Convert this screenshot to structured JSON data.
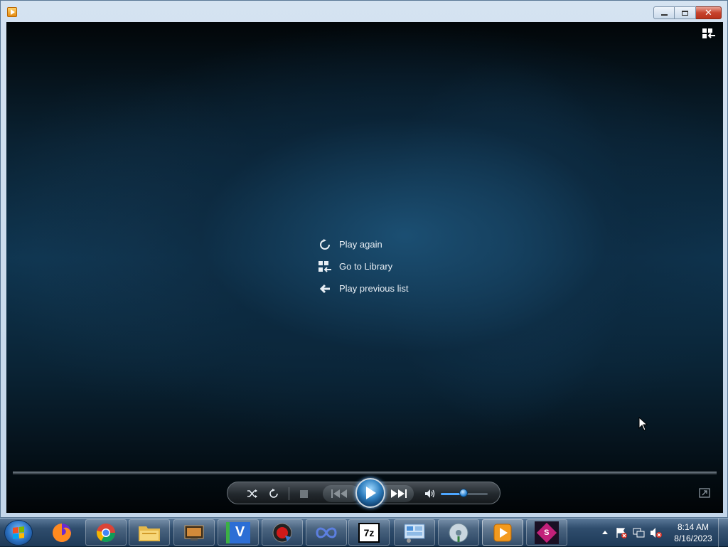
{
  "menu": {
    "items": [
      {
        "label": "Play again",
        "icon": "replay-icon"
      },
      {
        "label": "Go to Library",
        "icon": "library-icon"
      },
      {
        "label": "Play previous list",
        "icon": "back-arrow-icon"
      }
    ]
  },
  "player": {
    "volume_fraction": 0.5,
    "state": "stopped"
  },
  "taskbar": {
    "items": [
      {
        "name": "firefox",
        "icon": "firefox-icon"
      },
      {
        "name": "chrome",
        "icon": "chrome-icon"
      },
      {
        "name": "file-explorer",
        "icon": "folder-icon"
      },
      {
        "name": "media-app",
        "icon": "tv-icon"
      },
      {
        "name": "v-app",
        "icon": "v-icon"
      },
      {
        "name": "recorder",
        "icon": "record-icon"
      },
      {
        "name": "infinity-app",
        "icon": "infinity-icon"
      },
      {
        "name": "7zip",
        "icon": "7zip-icon"
      },
      {
        "name": "control-panel",
        "icon": "control-panel-icon"
      },
      {
        "name": "disk-app",
        "icon": "disk-icon"
      },
      {
        "name": "media-player",
        "icon": "media-player-icon"
      },
      {
        "name": "flash-designer",
        "icon": "flash-designer-icon"
      }
    ],
    "seven_zip_label": "7z",
    "v_label": "V",
    "s_label": "S"
  },
  "clock": {
    "time": "8:14 AM",
    "date": "8/16/2023"
  },
  "colors": {
    "accent": "#2f7fbf",
    "taskbar": "#2f4d6d",
    "close_button": "#c7432d"
  }
}
